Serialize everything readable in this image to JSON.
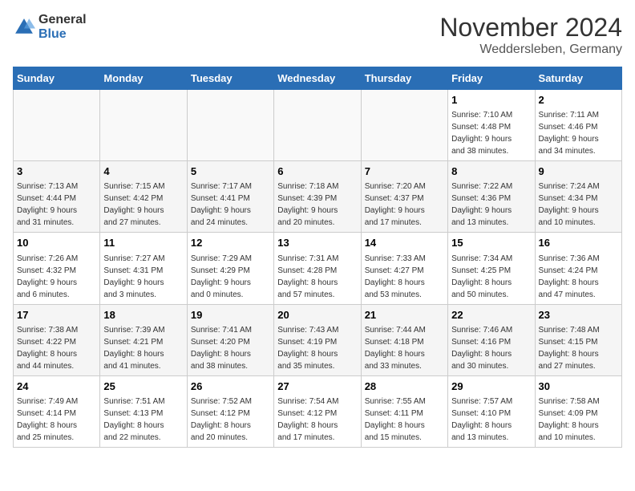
{
  "logo": {
    "general": "General",
    "blue": "Blue"
  },
  "header": {
    "month": "November 2024",
    "location": "Weddersleben, Germany"
  },
  "weekdays": [
    "Sunday",
    "Monday",
    "Tuesday",
    "Wednesday",
    "Thursday",
    "Friday",
    "Saturday"
  ],
  "weeks": [
    [
      {
        "day": "",
        "info": ""
      },
      {
        "day": "",
        "info": ""
      },
      {
        "day": "",
        "info": ""
      },
      {
        "day": "",
        "info": ""
      },
      {
        "day": "",
        "info": ""
      },
      {
        "day": "1",
        "info": "Sunrise: 7:10 AM\nSunset: 4:48 PM\nDaylight: 9 hours\nand 38 minutes."
      },
      {
        "day": "2",
        "info": "Sunrise: 7:11 AM\nSunset: 4:46 PM\nDaylight: 9 hours\nand 34 minutes."
      }
    ],
    [
      {
        "day": "3",
        "info": "Sunrise: 7:13 AM\nSunset: 4:44 PM\nDaylight: 9 hours\nand 31 minutes."
      },
      {
        "day": "4",
        "info": "Sunrise: 7:15 AM\nSunset: 4:42 PM\nDaylight: 9 hours\nand 27 minutes."
      },
      {
        "day": "5",
        "info": "Sunrise: 7:17 AM\nSunset: 4:41 PM\nDaylight: 9 hours\nand 24 minutes."
      },
      {
        "day": "6",
        "info": "Sunrise: 7:18 AM\nSunset: 4:39 PM\nDaylight: 9 hours\nand 20 minutes."
      },
      {
        "day": "7",
        "info": "Sunrise: 7:20 AM\nSunset: 4:37 PM\nDaylight: 9 hours\nand 17 minutes."
      },
      {
        "day": "8",
        "info": "Sunrise: 7:22 AM\nSunset: 4:36 PM\nDaylight: 9 hours\nand 13 minutes."
      },
      {
        "day": "9",
        "info": "Sunrise: 7:24 AM\nSunset: 4:34 PM\nDaylight: 9 hours\nand 10 minutes."
      }
    ],
    [
      {
        "day": "10",
        "info": "Sunrise: 7:26 AM\nSunset: 4:32 PM\nDaylight: 9 hours\nand 6 minutes."
      },
      {
        "day": "11",
        "info": "Sunrise: 7:27 AM\nSunset: 4:31 PM\nDaylight: 9 hours\nand 3 minutes."
      },
      {
        "day": "12",
        "info": "Sunrise: 7:29 AM\nSunset: 4:29 PM\nDaylight: 9 hours\nand 0 minutes."
      },
      {
        "day": "13",
        "info": "Sunrise: 7:31 AM\nSunset: 4:28 PM\nDaylight: 8 hours\nand 57 minutes."
      },
      {
        "day": "14",
        "info": "Sunrise: 7:33 AM\nSunset: 4:27 PM\nDaylight: 8 hours\nand 53 minutes."
      },
      {
        "day": "15",
        "info": "Sunrise: 7:34 AM\nSunset: 4:25 PM\nDaylight: 8 hours\nand 50 minutes."
      },
      {
        "day": "16",
        "info": "Sunrise: 7:36 AM\nSunset: 4:24 PM\nDaylight: 8 hours\nand 47 minutes."
      }
    ],
    [
      {
        "day": "17",
        "info": "Sunrise: 7:38 AM\nSunset: 4:22 PM\nDaylight: 8 hours\nand 44 minutes."
      },
      {
        "day": "18",
        "info": "Sunrise: 7:39 AM\nSunset: 4:21 PM\nDaylight: 8 hours\nand 41 minutes."
      },
      {
        "day": "19",
        "info": "Sunrise: 7:41 AM\nSunset: 4:20 PM\nDaylight: 8 hours\nand 38 minutes."
      },
      {
        "day": "20",
        "info": "Sunrise: 7:43 AM\nSunset: 4:19 PM\nDaylight: 8 hours\nand 35 minutes."
      },
      {
        "day": "21",
        "info": "Sunrise: 7:44 AM\nSunset: 4:18 PM\nDaylight: 8 hours\nand 33 minutes."
      },
      {
        "day": "22",
        "info": "Sunrise: 7:46 AM\nSunset: 4:16 PM\nDaylight: 8 hours\nand 30 minutes."
      },
      {
        "day": "23",
        "info": "Sunrise: 7:48 AM\nSunset: 4:15 PM\nDaylight: 8 hours\nand 27 minutes."
      }
    ],
    [
      {
        "day": "24",
        "info": "Sunrise: 7:49 AM\nSunset: 4:14 PM\nDaylight: 8 hours\nand 25 minutes."
      },
      {
        "day": "25",
        "info": "Sunrise: 7:51 AM\nSunset: 4:13 PM\nDaylight: 8 hours\nand 22 minutes."
      },
      {
        "day": "26",
        "info": "Sunrise: 7:52 AM\nSunset: 4:12 PM\nDaylight: 8 hours\nand 20 minutes."
      },
      {
        "day": "27",
        "info": "Sunrise: 7:54 AM\nSunset: 4:12 PM\nDaylight: 8 hours\nand 17 minutes."
      },
      {
        "day": "28",
        "info": "Sunrise: 7:55 AM\nSunset: 4:11 PM\nDaylight: 8 hours\nand 15 minutes."
      },
      {
        "day": "29",
        "info": "Sunrise: 7:57 AM\nSunset: 4:10 PM\nDaylight: 8 hours\nand 13 minutes."
      },
      {
        "day": "30",
        "info": "Sunrise: 7:58 AM\nSunset: 4:09 PM\nDaylight: 8 hours\nand 10 minutes."
      }
    ]
  ]
}
